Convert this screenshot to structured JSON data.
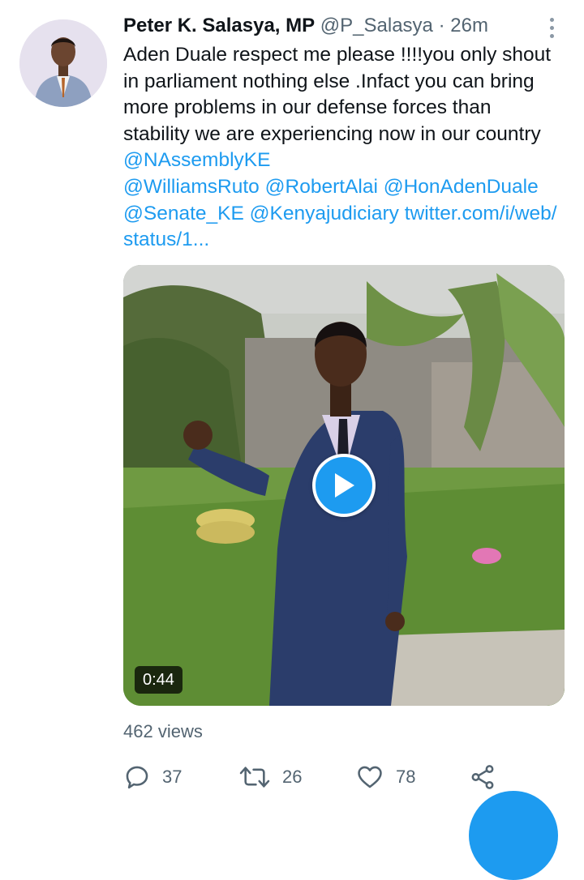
{
  "author": {
    "name": "Peter K. Salasya, MP",
    "handle": "@P_Salasya",
    "separator": "·",
    "time": "26m"
  },
  "tweet_text": {
    "line1": "Aden Duale respect me please !!!!you only shout",
    "line2": "in parliament nothing else .Infact you can bring",
    "line3": "more problems in our defense forces than",
    "line4": "stability we are experiencing now in our country",
    "mention1": "@NAssemblyKE",
    "mention2": "@WilliamsRuto",
    "mention3": "@RobertAlai",
    "mention4": "@HonAdenDuale",
    "mention5": "@Senate_KE",
    "mention6": "@Kenyajudiciary",
    "link": "twitter.com/i/web/",
    "link_cont": "status/1..."
  },
  "video": {
    "duration": "0:44"
  },
  "stats": {
    "views": "462 views"
  },
  "actions": {
    "reply_count": "37",
    "retweet_count": "26",
    "like_count": "78"
  },
  "icons": {
    "reply": "reply-icon",
    "retweet": "retweet-icon",
    "like": "heart-icon",
    "share": "share-icon",
    "more": "more-vertical-icon",
    "play": "play-icon"
  },
  "colors": {
    "accent": "#1d9bf0",
    "secondary_text": "#536471",
    "primary_text": "#0f1419"
  }
}
